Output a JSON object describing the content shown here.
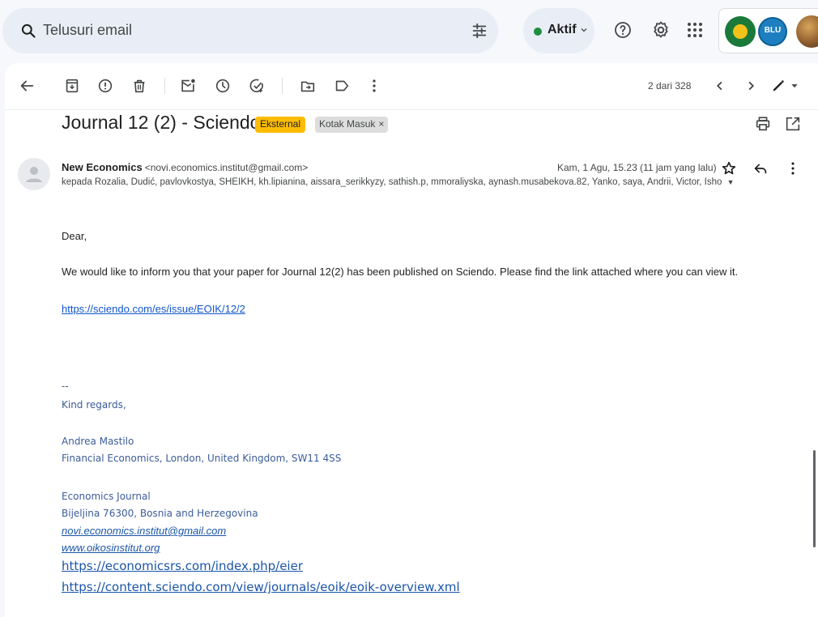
{
  "search": {
    "placeholder": "Telusuri email"
  },
  "status": {
    "label": "Aktif",
    "color": "#1e8e3e"
  },
  "header_icons": [
    "tune-icon",
    "help-icon",
    "settings-icon",
    "apps-grid-icon"
  ],
  "toolbar": {
    "icons": [
      "back-arrow-icon",
      "archive-icon",
      "report-spam-icon",
      "delete-icon",
      "mark-unread-icon",
      "snooze-icon",
      "add-task-icon",
      "move-to-icon",
      "label-icon",
      "more-vert-icon"
    ],
    "pager": "2 dari 328"
  },
  "email": {
    "subject": "Journal 12 (2) - Sciendo",
    "badges": {
      "external": "Eksternal",
      "inbox": "Kotak Masuk",
      "inbox_close": "×"
    },
    "sender_name": "New Economics",
    "sender_email": "<novi.economics.institut@gmail.com>",
    "date": "Kam, 1 Agu, 15.23 (11 jam yang lalu)",
    "recipients": "kepada Rozalia, Dudić, pavlovkostya, SHEIKH, kh.lipianina, aissara_serikkyzy, sathish.p, mmoraliyska, aynash.musabekova.82, Yanko, saya, Andrii, Victor, Isho",
    "greeting": "Dear,",
    "body_text": "We would like to inform you that your paper for Journal 12(2) has been published on Sciendo. Please find the link attached where you can view it.",
    "issue_link": "https://sciendo.com/es/issue/EOIK/12/2",
    "signature": {
      "dashes": "--",
      "regards": "Kind regards,",
      "name": "Andrea Mastilo",
      "address1": "Financial Economics, London, United Kingdom, SW11 4SS",
      "org": "Economics Journal",
      "address2": "Bijeljina 76300, Bosnia and Herzegovina",
      "email_link": "novi.economics.institut@gmail.com",
      "web_link": "www.oikosinstitut.org",
      "url1": "https://economicsrs.com/index.php/eier",
      "url2": "https://content.sciendo.com/view/journals/eoik/eoik-overview.xml"
    }
  },
  "colors": {
    "accent_link": "#1155cc",
    "badge_external": "#fbbc04",
    "signature_text": "#3b5c9a"
  },
  "account": {
    "logo2_text": "BLU"
  }
}
